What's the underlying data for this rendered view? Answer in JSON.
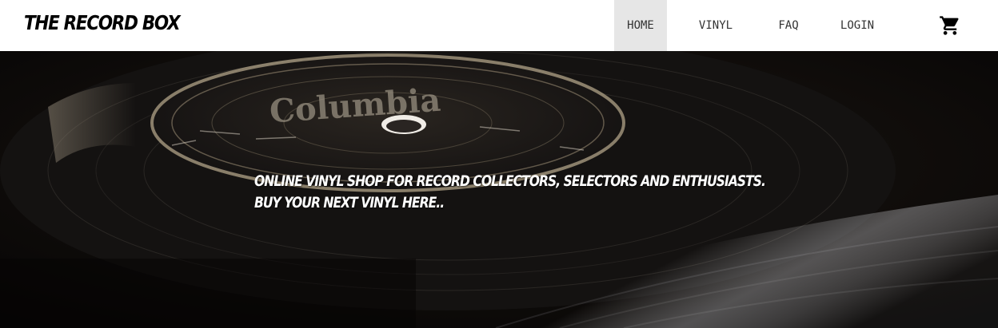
{
  "brand": {
    "name": "The Record Box"
  },
  "nav": {
    "items": [
      {
        "label": "HOME",
        "active": true
      },
      {
        "label": "VINYL",
        "active": false
      },
      {
        "label": "FAQ",
        "active": false
      },
      {
        "label": "LOGIN",
        "active": false
      }
    ],
    "cart_icon": "shopping-cart-icon"
  },
  "hero": {
    "label_text": "Columbia",
    "line1": "Online vinyl shop for record collectors, selectors and enthusiasts.",
    "line2": "Buy your next vinyl here.."
  },
  "colors": {
    "navbar_bg": "#ffffff",
    "active_nav_bg": "#e6e6e6",
    "hero_text": "#ffffff"
  }
}
